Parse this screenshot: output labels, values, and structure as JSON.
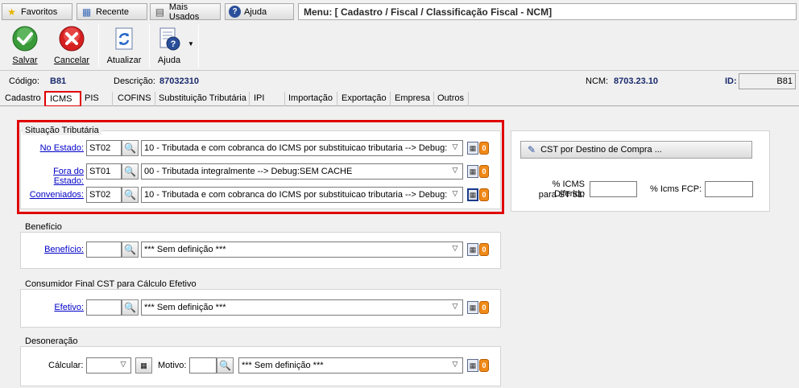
{
  "nav": {
    "favoritos": "Favoritos",
    "recente": "Recente",
    "mais_usados": "Mais Usados",
    "ajuda": "Ajuda",
    "menu_path": "Menu: [ Cadastro / Fiscal / Classificação Fiscal - NCM]"
  },
  "toolbar": {
    "salvar": "Salvar",
    "cancelar": "Cancelar",
    "atualizar": "Atualizar",
    "ajuda": "Ajuda"
  },
  "header": {
    "codigo_label": "Código:",
    "codigo_value": "B81",
    "descricao_label": "Descrição:",
    "descricao_value": "87032310",
    "ncm_label": "NCM:",
    "ncm_value": "8703.23.10",
    "id_label": "ID:",
    "id_value": "B81"
  },
  "tabs": [
    "Cadastro",
    "ICMS",
    "PIS",
    "COFINS",
    "Substituição Tributária",
    "IPI",
    "Importação",
    "Exportação",
    "Empresa",
    "Outros"
  ],
  "situacao": {
    "title": "Situação Tributária",
    "no_estado_label": "No Estado:",
    "no_estado_code": "ST02",
    "no_estado_desc": "10 - Tributada e com cobranca do ICMS por substituicao tributaria   --> Debug:",
    "fora_estado_label": "Fora do Estado:",
    "fora_estado_code": "ST01",
    "fora_estado_desc": "00 - Tributada integralmente   --> Debug:SEM CACHE",
    "conveniados_label": "Conveniados:",
    "conveniados_code": "ST02",
    "conveniados_desc": "10 - Tributada e com cobranca do ICMS por substituicao tributaria   --> Debug:"
  },
  "beneficio": {
    "title": "Benefício",
    "label": "Benefício:",
    "code": "",
    "desc": "*** Sem definição  ***"
  },
  "consumidor": {
    "title": "Consumidor Final CST para Cálculo Efetivo",
    "label": "Efetivo:",
    "code": "",
    "desc": "*** Sem definição  ***"
  },
  "desoneracao": {
    "title": "Desoneração",
    "calcular_label": "Cálcular:",
    "calcular_value": "",
    "motivo_label": "Motivo:",
    "motivo_code": "",
    "motivo_desc": "*** Sem definição  ***"
  },
  "right_panel": {
    "cst_button": "CST por Destino de Compra ...",
    "icms_diferido_label_1": "% ICMS Diferido",
    "icms_diferido_label_2": "para ST 51:",
    "icms_diferido_value": "",
    "icms_fcp_label": "% Icms FCP:",
    "icms_fcp_value": ""
  },
  "badge_text": "0",
  "colors": {
    "highlight_red": "#e00000",
    "link_blue": "#0000c8",
    "value_navy": "#1a2a6c",
    "badge_orange": "#f08a18"
  }
}
